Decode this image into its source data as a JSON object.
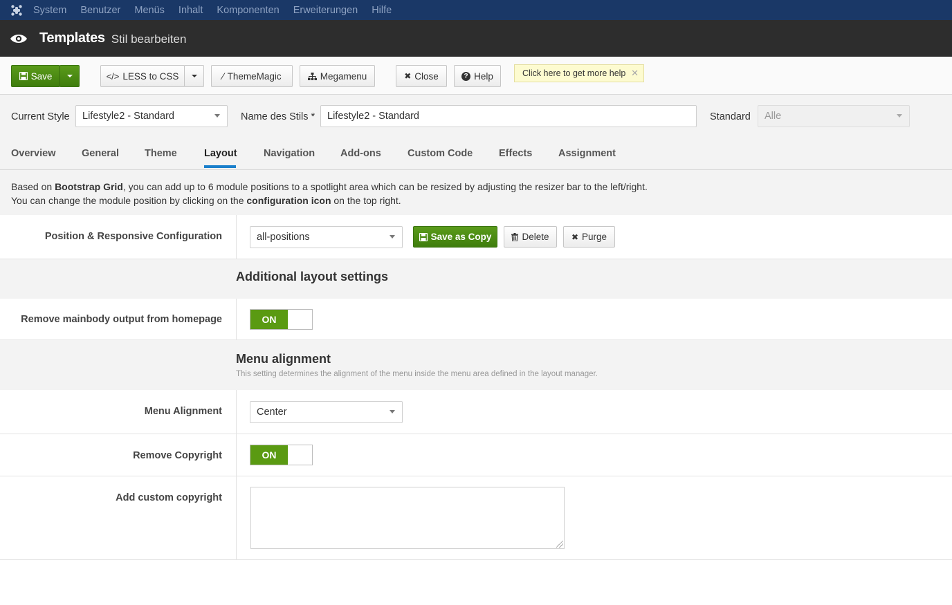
{
  "topnav": {
    "items": [
      "System",
      "Benutzer",
      "Menüs",
      "Inhalt",
      "Komponenten",
      "Erweiterungen",
      "Hilfe"
    ]
  },
  "header": {
    "title": "Templates",
    "subtitle": "Stil bearbeiten"
  },
  "toolbar": {
    "save": "Save",
    "less_to_css": "LESS to CSS",
    "thememagic": "ThemeMagic",
    "megamenu": "Megamenu",
    "close": "Close",
    "help": "Help",
    "help_tip": "Click here to get more help"
  },
  "style_row": {
    "current_style_label": "Current Style",
    "current_style_value": "Lifestyle2 - Standard",
    "name_label": "Name des Stils *",
    "name_value": "Lifestyle2 - Standard",
    "standard_label": "Standard",
    "standard_value": "Alle"
  },
  "tabs": [
    "Overview",
    "General",
    "Theme",
    "Layout",
    "Navigation",
    "Add-ons",
    "Custom Code",
    "Effects",
    "Assignment"
  ],
  "active_tab": "Layout",
  "info": {
    "line1_pre": "Based on ",
    "line1_bold": "Bootstrap Grid",
    "line1_post": ", you can add up to 6 module positions to a spotlight area which can be resized by adjusting the resizer bar to the left/right.",
    "line2_pre": "You can change the module position by clicking on the ",
    "line2_bold": "configuration icon",
    "line2_post": " on the top right."
  },
  "position_config": {
    "label": "Position & Responsive Configuration",
    "select_value": "all-positions",
    "save_as_copy": "Save as Copy",
    "delete": "Delete",
    "purge": "Purge"
  },
  "additional_layout": {
    "title": "Additional layout settings"
  },
  "remove_mainbody": {
    "label": "Remove mainbody output from homepage",
    "toggle": "ON"
  },
  "menu_alignment_section": {
    "title": "Menu alignment",
    "desc": "This setting determines the alignment of the menu inside the menu area defined in the layout manager."
  },
  "menu_alignment": {
    "label": "Menu Alignment",
    "value": "Center"
  },
  "remove_copyright": {
    "label": "Remove Copyright",
    "toggle": "ON"
  },
  "custom_copyright": {
    "label": "Add custom copyright",
    "value": ""
  }
}
